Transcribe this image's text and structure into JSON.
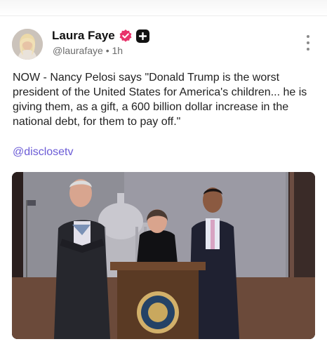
{
  "header": {
    "divider": true
  },
  "post": {
    "author": {
      "name": "Laura Faye",
      "handle": "@laurafaye",
      "separator": "•",
      "time": "1h",
      "verified_color": "#e8336b",
      "badge_icon": "plus-icon"
    },
    "text": "NOW - Nancy Pelosi says \"Donald Trump is the worst president of the United States for America's children... he is giving them, as a gift, a 600 billion dollar increase in the national debt, for them to pay off.\"",
    "link": "@disclosetv",
    "media": {
      "type": "photo",
      "description_icon": "press-conference-photo"
    },
    "menu_icon": "more-vertical-icon"
  },
  "colors": {
    "link": "#6b5bd6",
    "verified": "#e8336b",
    "badge": "#121212"
  }
}
